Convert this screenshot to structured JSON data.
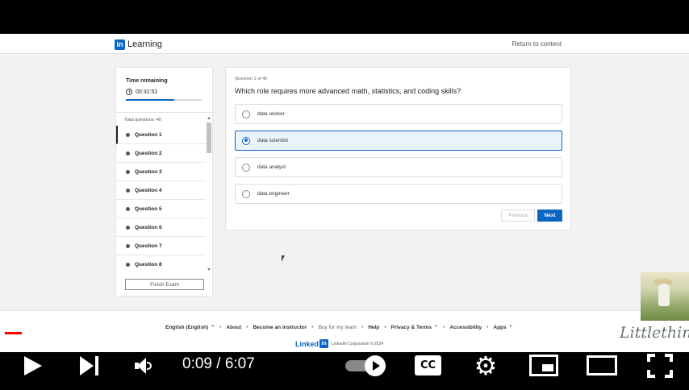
{
  "topbar": {
    "logo_mark": "in",
    "logo_text": "Learning",
    "return_link": "Return to content"
  },
  "sidebar": {
    "time_label": "Time remaining",
    "time_value": "00:32:52",
    "time_progress_fraction": 0.64,
    "total_label": "Total questions: 40",
    "questions": [
      {
        "label": "Question 1",
        "active": true
      },
      {
        "label": "Question 2",
        "active": false
      },
      {
        "label": "Question 3",
        "active": false
      },
      {
        "label": "Question 4",
        "active": false
      },
      {
        "label": "Question 5",
        "active": false
      },
      {
        "label": "Question 6",
        "active": false
      },
      {
        "label": "Question 7",
        "active": false
      },
      {
        "label": "Question 8",
        "active": false
      }
    ],
    "finish_label": "Finish Exam"
  },
  "question": {
    "counter": "Question 1 of 40",
    "text": "Which role requires more advanced math, statistics, and coding skills?",
    "options": [
      {
        "label": "data worker",
        "selected": false
      },
      {
        "label": "data scientist",
        "selected": true
      },
      {
        "label": "data analyst",
        "selected": false
      },
      {
        "label": "data engineer",
        "selected": false
      }
    ],
    "previous_label": "Previous",
    "next_label": "Next"
  },
  "footer": {
    "language": "English (English)",
    "links": [
      "About",
      "Become an Instructor",
      "Buy for my team",
      "Help",
      "Privacy & Terms",
      "Accessibility",
      "Apps"
    ],
    "brand_text": "Linked",
    "brand_box": "in",
    "corp_text": "LinkedIn Corporation © 2024"
  },
  "overlay": {
    "watermark": "Littlething"
  },
  "player": {
    "time": "0:09 / 6:07",
    "progress_fraction": 0.025,
    "cc_label": "CC",
    "gear_glyph": "⚙"
  },
  "colors": {
    "accent": "#0a66c2",
    "progress_red": "#ff0000",
    "selected_bg": "#e8f3fb"
  }
}
